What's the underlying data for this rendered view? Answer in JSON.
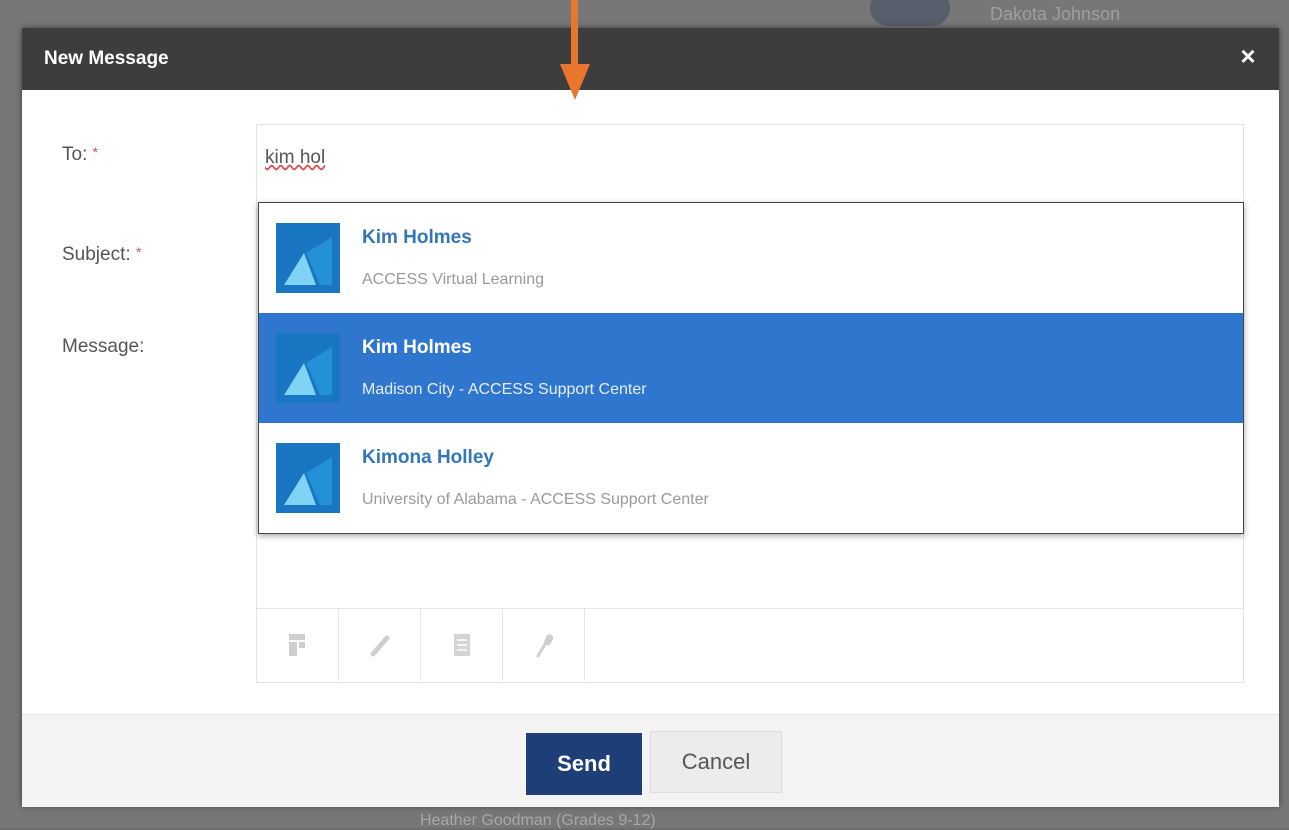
{
  "background": {
    "user_name": "Dakota Johnson",
    "footer_text": "Heather Goodman (Grades 9-12)"
  },
  "dialog": {
    "title": "New Message",
    "close_glyph": "×"
  },
  "form": {
    "to_label": "To:",
    "subject_label": "Subject:",
    "message_label": "Message:",
    "required_marker": "*",
    "to_value": "kim hol"
  },
  "autocomplete": {
    "options": [
      {
        "name": "Kim Holmes",
        "organization": "ACCESS Virtual Learning",
        "selected": false
      },
      {
        "name": "Kim Holmes",
        "organization": "Madison City - ACCESS Support Center",
        "selected": true
      },
      {
        "name": "Kimona Holley",
        "organization": "University of Alabama - ACCESS Support Center",
        "selected": false
      }
    ]
  },
  "editor_toolbar": {
    "buttons": [
      "insert-icon",
      "link-icon",
      "document-icon",
      "microphone-icon"
    ]
  },
  "buttons": {
    "send": "Send",
    "cancel": "Cancel"
  },
  "colors": {
    "titlebar": "#3d3d3d",
    "selected_option": "#2f76cf",
    "send_button": "#1e3e78",
    "annotation_arrow": "#e8762d",
    "option_icon": "#1976c2"
  }
}
